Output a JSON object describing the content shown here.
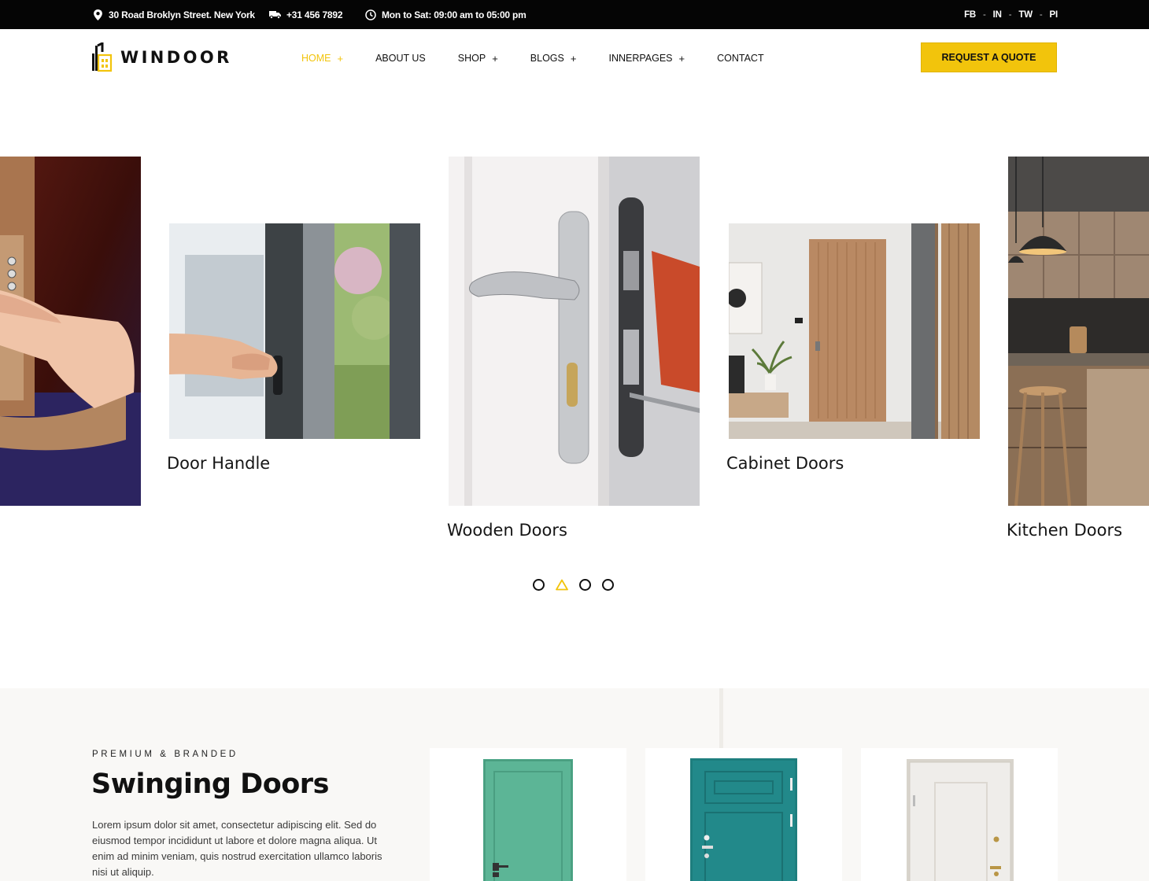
{
  "topbar": {
    "address": "30 Road Broklyn Street. New York",
    "phone": "+31 456 7892",
    "hours": "Mon to Sat: 09:00 am to 05:00 pm",
    "socials": [
      "FB",
      "IN",
      "TW",
      "PI"
    ],
    "separator": "-"
  },
  "header": {
    "logo_text": "WINDOOR",
    "nav": [
      {
        "label": "HOME",
        "plus": "+",
        "active": true
      },
      {
        "label": "ABOUT US",
        "plus": ""
      },
      {
        "label": "SHOP",
        "plus": "+"
      },
      {
        "label": "BLOGS",
        "plus": "+"
      },
      {
        "label": "INNERPAGES",
        "plus": "+"
      },
      {
        "label": "CONTACT",
        "plus": ""
      }
    ],
    "cta_label": "REQUEST A QUOTE"
  },
  "carousel": {
    "cards": [
      {
        "title": "Door Handle",
        "icon": "window-handle-photo"
      },
      {
        "title": "Wooden Doors",
        "icon": "door-lock-photo"
      },
      {
        "title": "Cabinet Doors",
        "icon": "interior-door-photo"
      },
      {
        "title": "Kitchen Doors",
        "icon": "kitchen-photo"
      }
    ],
    "dot_count": 4,
    "active_dot": 2
  },
  "section": {
    "eyebrow": "PREMIUM & BRANDED",
    "title": "Swinging Doors",
    "body": "Lorem ipsum dolor sit amet, consectetur adipiscing elit. Sed do eiusmod tempor incididunt ut labore et dolore magna aliqua. Ut enim ad minim veniam, quis nostrud exercitation ullamco laboris nisi ut aliquip.",
    "products": [
      {
        "icon": "green-door-photo"
      },
      {
        "icon": "teal-door-photo"
      },
      {
        "icon": "white-door-photo"
      }
    ]
  },
  "colors": {
    "accent": "#f2c40c",
    "topbar": "#050505",
    "section_bg": "#f9f8f6"
  }
}
